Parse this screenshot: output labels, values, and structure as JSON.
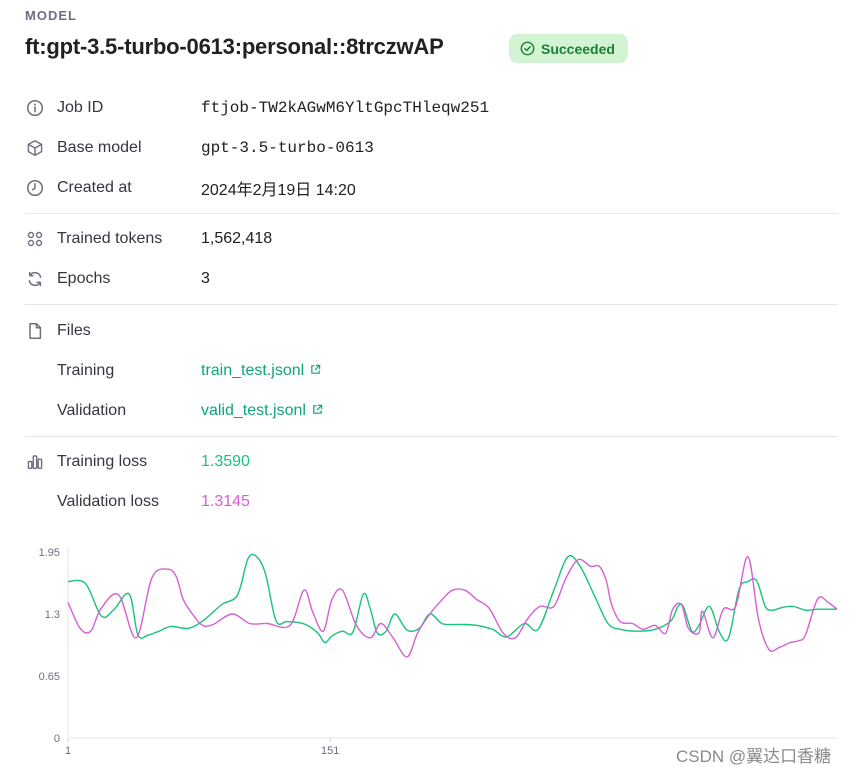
{
  "header": {
    "section_label": "MODEL",
    "model_name": "ft:gpt-3.5-turbo-0613:personal::8trczwAP",
    "status": "Succeeded",
    "status_color": "#1a7f37",
    "status_bg": "#d2f4d3"
  },
  "details": {
    "job_id_label": "Job ID",
    "job_id": "ftjob-TW2kAGwM6YltGpcTHleqw251",
    "base_model_label": "Base model",
    "base_model": "gpt-3.5-turbo-0613",
    "created_at_label": "Created at",
    "created_at": "2024年2月19日 14:20",
    "trained_tokens_label": "Trained tokens",
    "trained_tokens": "1,562,418",
    "epochs_label": "Epochs",
    "epochs": "3"
  },
  "files": {
    "label": "Files",
    "training_label": "Training",
    "training_file": "train_test.jsonl",
    "validation_label": "Validation",
    "validation_file": "valid_test.jsonl"
  },
  "metrics": {
    "training_loss_label": "Training loss",
    "training_loss": "1.3590",
    "validation_loss_label": "Validation loss",
    "validation_loss": "1.3145",
    "training_color": "#19c37d",
    "validation_color": "#d65fd4"
  },
  "chart_data": {
    "type": "line",
    "ylim": [
      0,
      1.95
    ],
    "xlim": [
      1,
      441
    ],
    "y_ticks": [
      "1.95",
      "1.3",
      "0.65",
      "0"
    ],
    "x_ticks": [
      "1",
      "151"
    ],
    "grid": false,
    "series": [
      {
        "color": "#19c37d",
        "x": [
          1,
          11,
          20,
          27,
          36,
          41,
          47,
          53,
          60,
          70,
          79,
          89,
          98,
          104,
          109,
          114,
          120,
          126,
          133,
          138,
          144,
          148,
          152,
          158,
          164,
          170,
          174,
          178,
          183,
          188,
          195,
          202,
          208,
          215,
          222,
          228,
          235,
          244,
          252,
          262,
          270,
          279,
          287,
          294,
          302,
          310,
          317,
          327,
          337,
          346,
          350,
          353,
          358,
          362,
          368,
          374,
          379,
          385,
          390,
          395,
          400,
          404,
          410,
          416,
          423,
          430,
          436,
          441
        ],
        "y": [
          1.64,
          1.62,
          1.28,
          1.34,
          1.51,
          1.08,
          1.08,
          1.12,
          1.17,
          1.15,
          1.24,
          1.4,
          1.5,
          1.88,
          1.9,
          1.72,
          1.23,
          1.22,
          1.21,
          1.18,
          1.1,
          1.0,
          1.07,
          1.12,
          1.11,
          1.51,
          1.35,
          1.1,
          1.12,
          1.3,
          1.13,
          1.15,
          1.3,
          1.2,
          1.19,
          1.19,
          1.18,
          1.14,
          1.06,
          1.2,
          1.14,
          1.55,
          1.9,
          1.8,
          1.5,
          1.2,
          1.14,
          1.12,
          1.14,
          1.23,
          1.38,
          1.38,
          1.12,
          1.18,
          1.38,
          1.1,
          1.05,
          1.56,
          1.64,
          1.65,
          1.38,
          1.34,
          1.37,
          1.38,
          1.34,
          1.35,
          1.35,
          1.35
        ]
      },
      {
        "color": "#d65fd4",
        "x": [
          1,
          8,
          14,
          20,
          30,
          40,
          49,
          58,
          63,
          67,
          73,
          78,
          84,
          95,
          105,
          115,
          128,
          136,
          141,
          147,
          152,
          158,
          166,
          174,
          180,
          187,
          195,
          201,
          208,
          215,
          221,
          228,
          235,
          242,
          250,
          257,
          264,
          271,
          279,
          286,
          293,
          300,
          305,
          309,
          312,
          317,
          324,
          330,
          337,
          343,
          347,
          352,
          356,
          362,
          364,
          370,
          376,
          383,
          390,
          396,
          402,
          408,
          414,
          419,
          423,
          430,
          436,
          441
        ],
        "y": [
          1.42,
          1.15,
          1.12,
          1.36,
          1.5,
          1.05,
          1.68,
          1.77,
          1.69,
          1.45,
          1.28,
          1.18,
          1.19,
          1.3,
          1.2,
          1.2,
          1.18,
          1.55,
          1.32,
          1.12,
          1.45,
          1.55,
          1.18,
          1.05,
          1.2,
          1.05,
          0.85,
          1.1,
          1.3,
          1.45,
          1.55,
          1.55,
          1.45,
          1.36,
          1.1,
          1.05,
          1.25,
          1.38,
          1.38,
          1.68,
          1.87,
          1.8,
          1.8,
          1.65,
          1.4,
          1.22,
          1.2,
          1.14,
          1.18,
          1.1,
          1.35,
          1.4,
          1.15,
          1.1,
          1.33,
          1.05,
          1.35,
          1.38,
          1.9,
          1.25,
          0.93,
          0.95,
          1.0,
          1.02,
          1.08,
          1.46,
          1.42,
          1.35
        ]
      }
    ]
  },
  "watermark": "CSDN @翼达口香糖"
}
